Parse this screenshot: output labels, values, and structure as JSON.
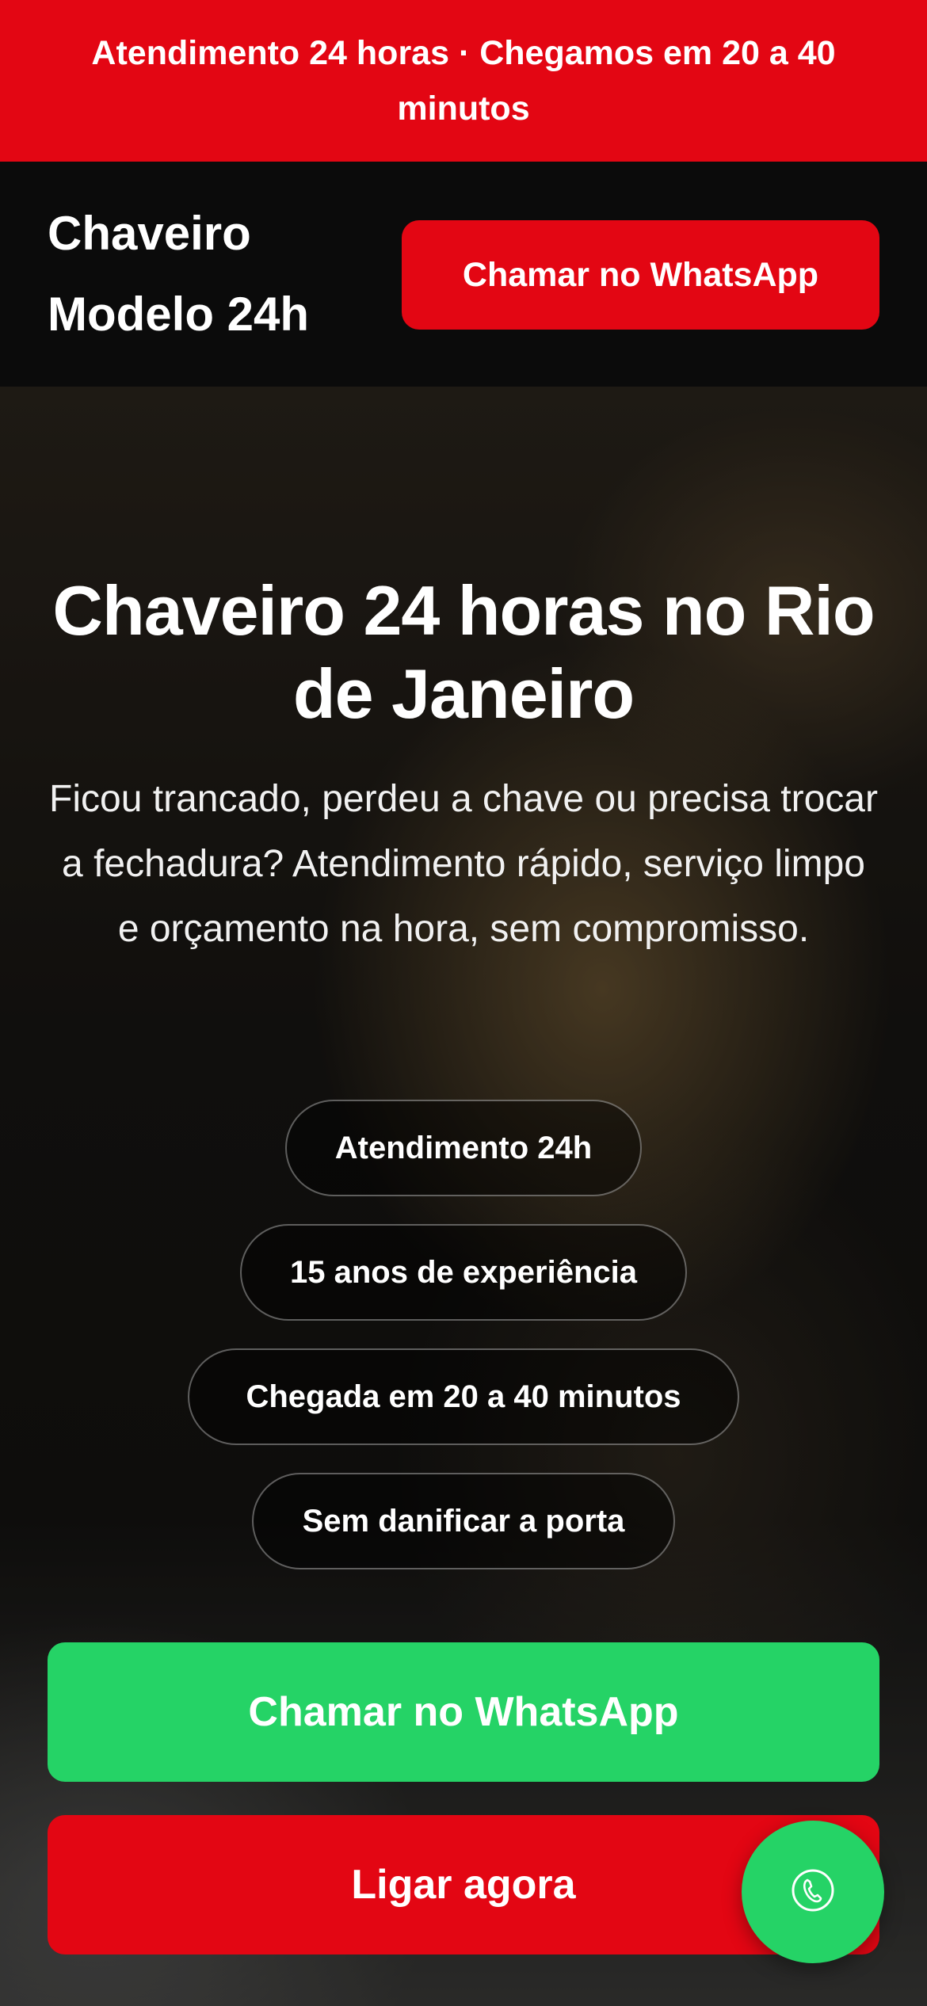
{
  "topbar": {
    "text": "Atendimento 24 horas · Chegamos em 20 a 40 minutos"
  },
  "header": {
    "brand": "Chaveiro Modelo 24h",
    "cta_label": "Chamar no WhatsApp"
  },
  "hero": {
    "title": "Chaveiro 24 horas no Rio de Janeiro",
    "text": "Ficou trancado, perdeu a chave ou precisa trocar a fechadura? Atendimento rápido, serviço limpo e orçamento na hora, sem compromisso.",
    "badges": [
      {
        "label": "Atendimento 24h"
      },
      {
        "label": "15 anos de experiência"
      },
      {
        "label": "Chegada em 20 a 40 minutos"
      },
      {
        "label": "Sem danificar a porta"
      }
    ],
    "whatsapp_label": "Chamar no WhatsApp",
    "call_label": "Ligar agora"
  },
  "fab": {
    "icon": "phone-icon"
  },
  "colors": {
    "brand_red": "#e30613",
    "whatsapp_green": "#25d366",
    "header_bg": "#0b0b0b"
  }
}
